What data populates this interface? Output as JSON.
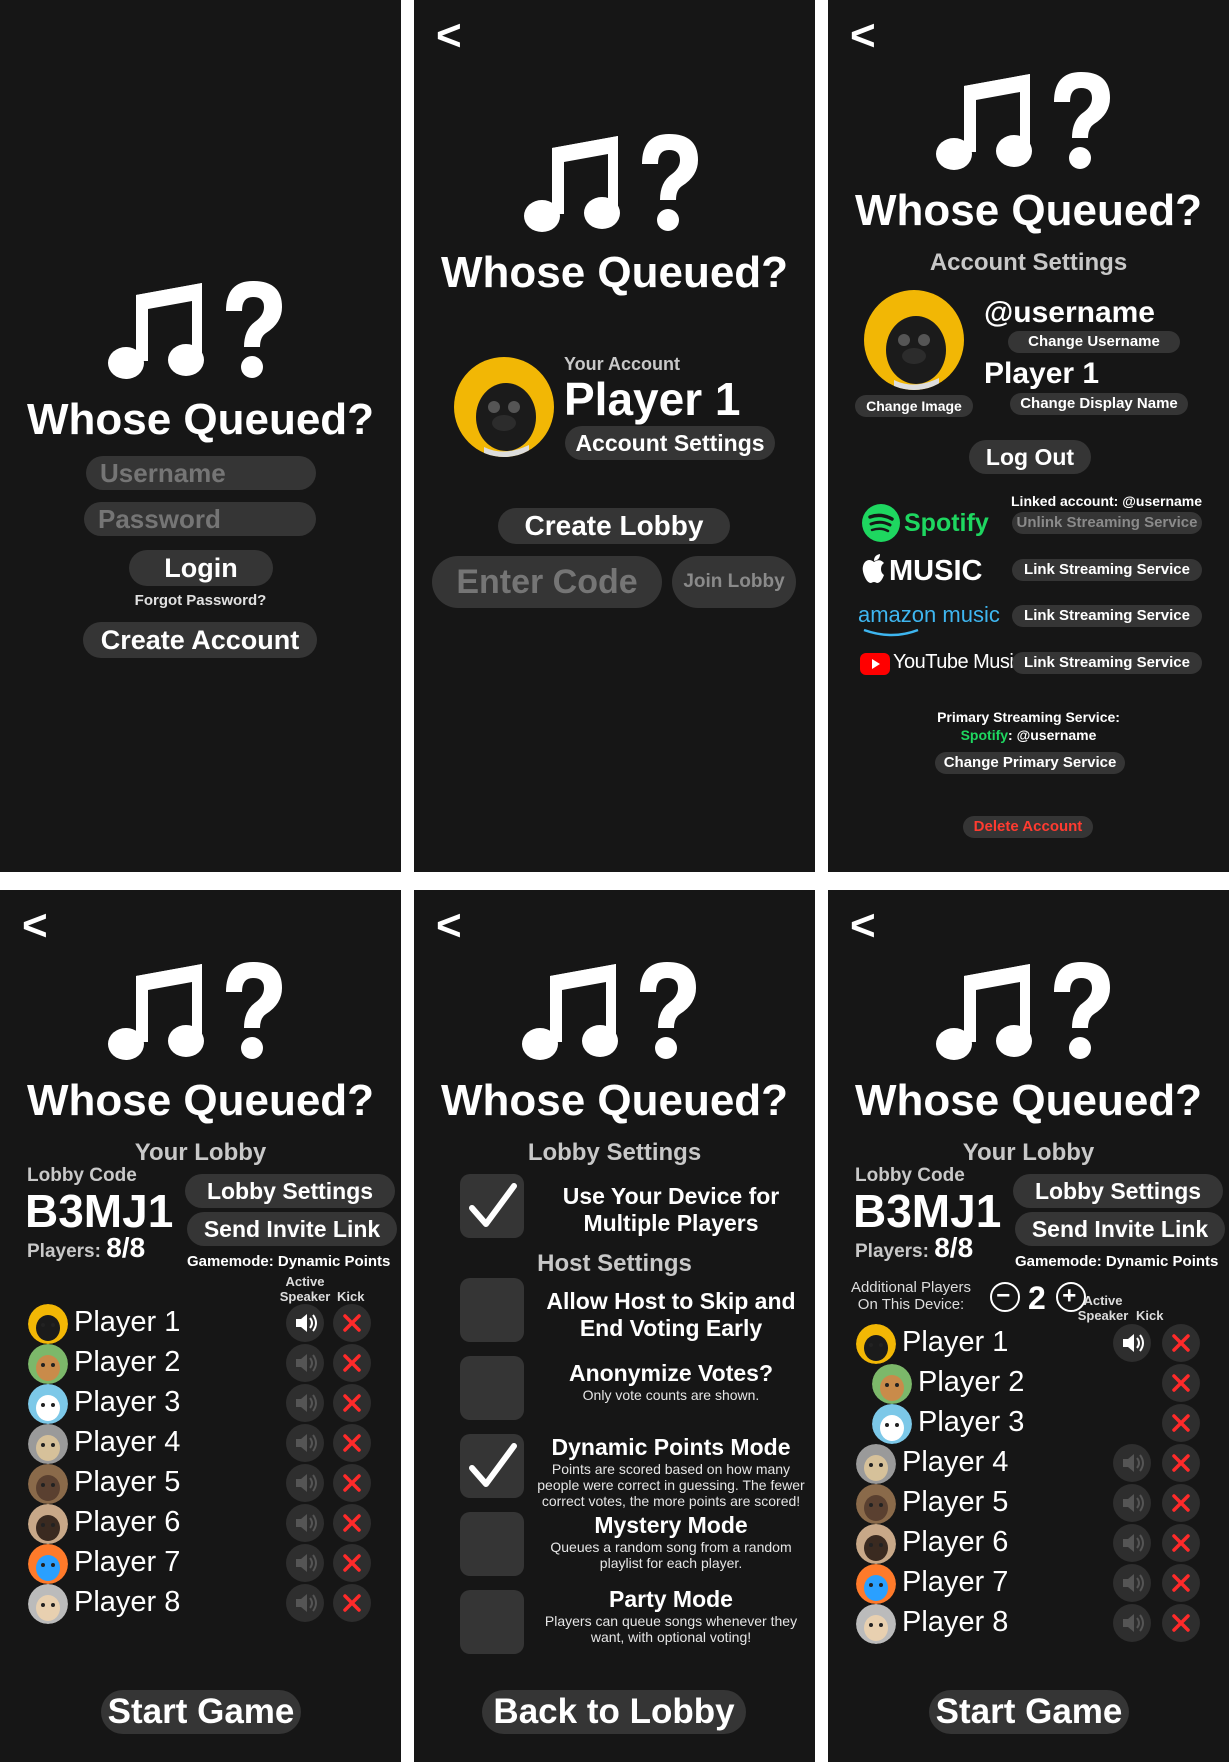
{
  "app": {
    "title": "Whose Queued?",
    "back": "<"
  },
  "login": {
    "username_placeholder": "Username",
    "password_placeholder": "Password",
    "login_label": "Login",
    "forgot_label": "Forgot Password?",
    "create_account_label": "Create Account"
  },
  "home": {
    "your_account": "Your Account",
    "player_name": "Player 1",
    "account_settings_label": "Account Settings",
    "create_lobby_label": "Create Lobby",
    "enter_code_placeholder": "Enter Code",
    "join_lobby_label": "Join Lobby"
  },
  "account": {
    "heading": "Account Settings",
    "username": "@username",
    "change_username": "Change Username",
    "display_name": "Player 1",
    "change_display_name": "Change Display Name",
    "change_image": "Change Image",
    "log_out": "Log Out",
    "linked_account": "Linked account: @username",
    "services": [
      {
        "name": "Spotify",
        "action": "Unlink Streaming Service",
        "linked": true
      },
      {
        "name": "MUSIC",
        "action": "Link Streaming Service",
        "linked": false
      },
      {
        "name": "amazon music",
        "action": "Link Streaming Service",
        "linked": false
      },
      {
        "name": "YouTube Music",
        "action": "Link Streaming Service",
        "linked": false
      }
    ],
    "primary_label": "Primary Streaming Service:",
    "primary_service": "Spotify",
    "primary_user": ": @username",
    "change_primary": "Change Primary Service",
    "delete_account": "Delete Account",
    "colors": {
      "spotify": "#1ed760",
      "delete": "#ff3b30",
      "youtube": "#ff0000",
      "amazon": "#3eb6f0"
    }
  },
  "lobby": {
    "heading": "Your Lobby",
    "code_label": "Lobby Code",
    "code": "B3MJ1",
    "players_label": "Players:",
    "players_count": "8/8",
    "lobby_settings_label": "Lobby Settings",
    "send_invite_label": "Send Invite Link",
    "gamemode": "Gamemode: Dynamic Points",
    "active_speaker_label": "Active Speaker",
    "kick_label": "Kick",
    "start_game_label": "Start Game",
    "players": [
      "Player 1",
      "Player 2",
      "Player 3",
      "Player 4",
      "Player 5",
      "Player 6",
      "Player 7",
      "Player 8"
    ],
    "additional_players_label": "Additional Players On This Device:",
    "additional_players_count": "2",
    "minus": "−",
    "plus": "+"
  },
  "settings": {
    "heading": "Lobby Settings",
    "host_heading": "Host Settings",
    "back_to_lobby_label": "Back to Lobby",
    "device_option": {
      "title": "Use Your Device for Multiple Players",
      "checked": true
    },
    "options": [
      {
        "title": "Allow Host to Skip and End Voting Early",
        "desc": "",
        "checked": false
      },
      {
        "title": "Anonymize Votes?",
        "desc": "Only vote counts are shown.",
        "checked": false
      },
      {
        "title": "Dynamic Points Mode",
        "desc": "Points are scored based on how many people were correct in guessing. The fewer correct votes, the more points are scored!",
        "checked": true
      },
      {
        "title": "Mystery Mode",
        "desc": "Queues a random song from a random playlist for each player.",
        "checked": false
      },
      {
        "title": "Party Mode",
        "desc": "Players can queue songs whenever they want, with optional voting!",
        "checked": false
      }
    ]
  }
}
